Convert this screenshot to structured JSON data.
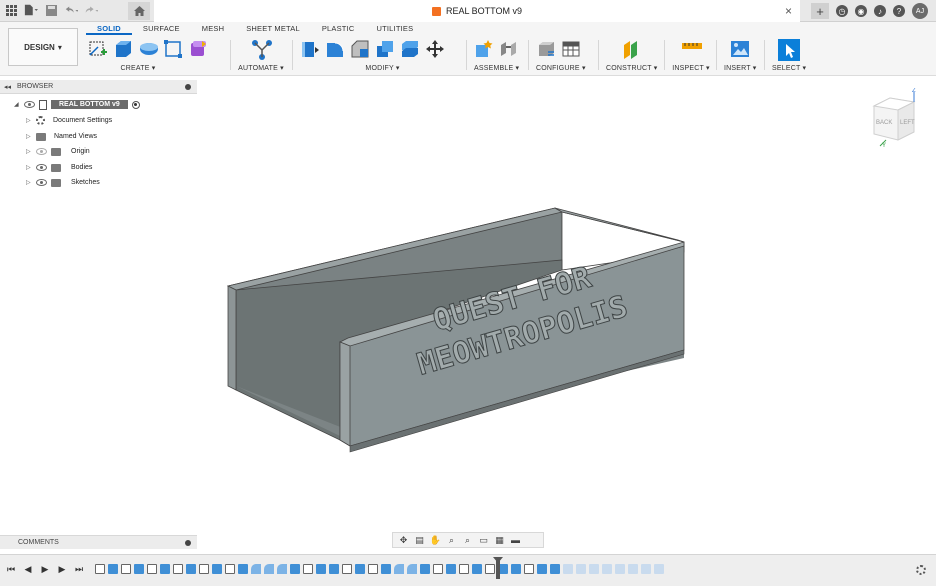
{
  "titlebar": {
    "document_title": "REAL BOTTOM v9",
    "user_initials": "AJ",
    "close_glyph": "×",
    "new_tab_glyph": "+"
  },
  "toolbar": {
    "design_label": "DESIGN",
    "tabs": [
      "SOLID",
      "SURFACE",
      "MESH",
      "SHEET METAL",
      "PLASTIC",
      "UTILITIES"
    ],
    "active_tab": "SOLID",
    "groups": {
      "create": "CREATE",
      "automate": "AUTOMATE",
      "modify": "MODIFY",
      "assemble": "ASSEMBLE",
      "configure": "CONFIGURE",
      "construct": "CONSTRUCT",
      "inspect": "INSPECT",
      "insert": "INSERT",
      "select": "SELECT"
    }
  },
  "browser": {
    "header": "BROWSER",
    "root": "REAL BOTTOM v9",
    "items": [
      "Document Settings",
      "Named Views",
      "Origin",
      "Bodies",
      "Sketches"
    ]
  },
  "viewcube": {
    "back": "BACK",
    "left": "LEFT",
    "z": "Z",
    "y": "Y"
  },
  "model": {
    "text_line1": "QUEST FOR",
    "text_line2": "MEOWTROPOLIS"
  },
  "comments": {
    "label": "COMMENTS"
  },
  "colors": {
    "accent": "#0b67c4",
    "model_face": "#8a9496",
    "model_inner": "#6f7776",
    "timeline_body": "#3f8fd6"
  }
}
